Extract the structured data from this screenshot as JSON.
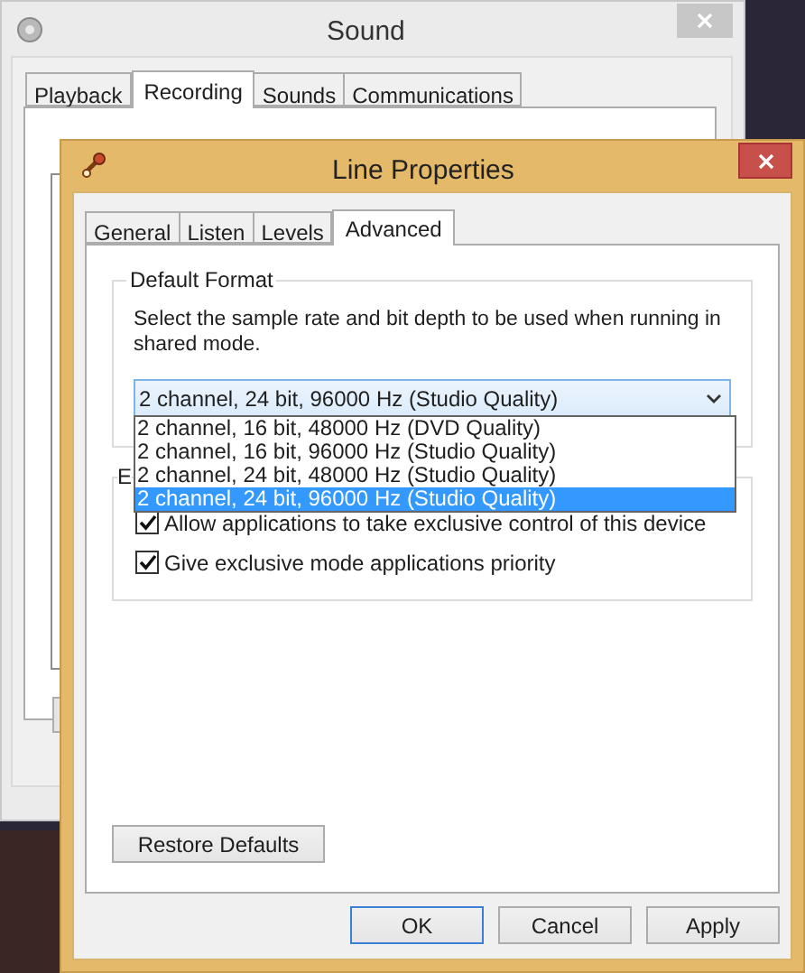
{
  "sound_window": {
    "title": "Sound",
    "tabs": [
      {
        "label": "Playback",
        "selected": false
      },
      {
        "label": "Recording",
        "selected": true
      },
      {
        "label": "Sounds",
        "selected": false
      },
      {
        "label": "Communications",
        "selected": false
      }
    ]
  },
  "line_properties": {
    "title": "Line Properties",
    "tabs": [
      {
        "label": "General",
        "selected": false
      },
      {
        "label": "Listen",
        "selected": false
      },
      {
        "label": "Levels",
        "selected": false
      },
      {
        "label": "Advanced",
        "selected": true
      }
    ],
    "default_format": {
      "title": "Default Format",
      "description": "Select the sample rate and bit depth to be used when running in shared mode.",
      "dropdown": {
        "value": "2 channel, 24 bit, 96000 Hz (Studio Quality)",
        "expanded": true,
        "options": [
          {
            "label": "2 channel, 16 bit, 48000 Hz (DVD Quality)",
            "selected": false
          },
          {
            "label": "2 channel, 16 bit, 96000 Hz (Studio Quality)",
            "selected": false
          },
          {
            "label": "2 channel, 24 bit, 48000 Hz (Studio Quality)",
            "selected": false
          },
          {
            "label": "2 channel, 24 bit, 96000 Hz (Studio Quality)",
            "selected": true
          }
        ]
      }
    },
    "exclusive_mode": {
      "title": "E",
      "options": [
        {
          "label": "Allow applications to take exclusive control of this device",
          "checked": true
        },
        {
          "label": "Give exclusive mode applications priority",
          "checked": true
        }
      ]
    },
    "restore_button": "Restore Defaults",
    "buttons": [
      {
        "label": "OK",
        "focused": true
      },
      {
        "label": "Cancel",
        "focused": false
      },
      {
        "label": "Apply",
        "focused": false
      }
    ]
  }
}
